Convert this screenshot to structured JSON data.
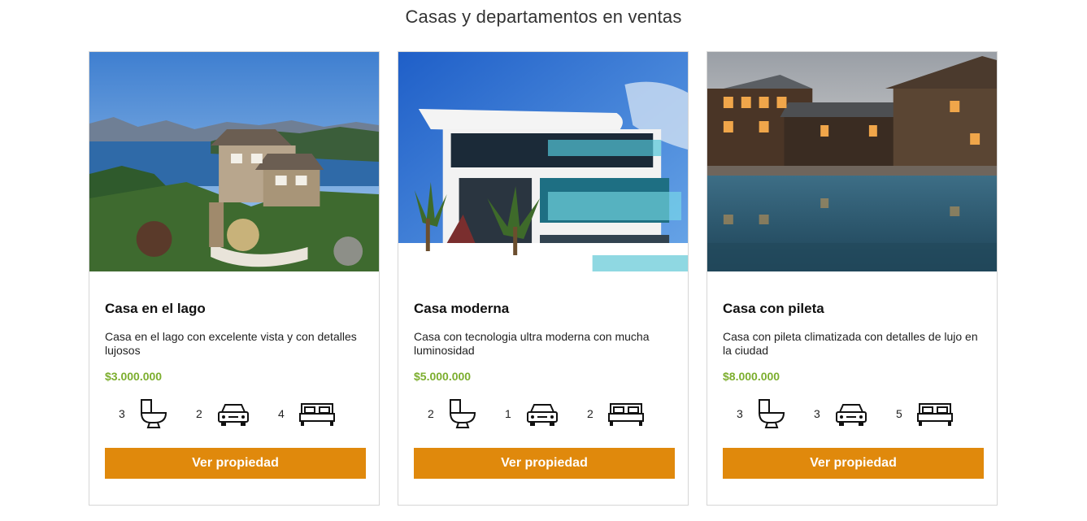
{
  "page": {
    "heading": "Casas y departamentos en ventas"
  },
  "properties": [
    {
      "title": "Casa en el lago",
      "description": "Casa en el lago con excelente vista y con detalles lujosos",
      "price": "$3.000.000",
      "bathrooms": "3",
      "parking": "2",
      "bedrooms": "4",
      "button_label": "Ver propiedad"
    },
    {
      "title": "Casa moderna",
      "description": "Casa con tecnologia ultra moderna con mucha luminosidad",
      "price": "$5.000.000",
      "bathrooms": "2",
      "parking": "1",
      "bedrooms": "2",
      "button_label": "Ver propiedad"
    },
    {
      "title": "Casa con pileta",
      "description": "Casa con pileta climatizada con detalles de lujo en la ciudad",
      "price": "$8.000.000",
      "bathrooms": "3",
      "parking": "3",
      "bedrooms": "5",
      "button_label": "Ver propiedad"
    }
  ],
  "icons": {
    "bathroom": "toilet-icon",
    "parking": "car-icon",
    "bedroom": "bed-icon"
  },
  "colors": {
    "button": "#e0890c",
    "price": "#7cae2e"
  }
}
